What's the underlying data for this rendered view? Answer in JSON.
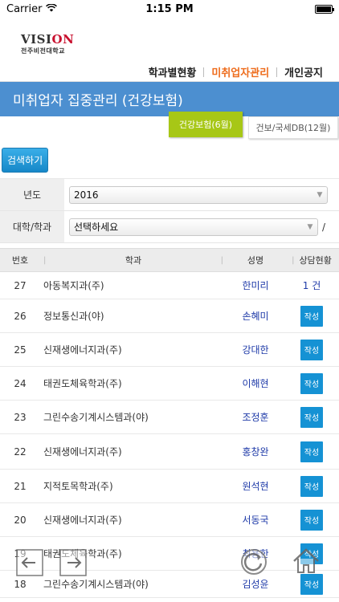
{
  "status": {
    "carrier": "Carrier",
    "time": "1:15 PM"
  },
  "logo": {
    "main_prefix": "VISI",
    "main_suffix": "ON",
    "sub": "전주비전대학교"
  },
  "nav": {
    "items": [
      {
        "label": "학과별현황",
        "active": false
      },
      {
        "label": "미취업자관리",
        "active": true
      },
      {
        "label": "개인공지",
        "active": false
      }
    ]
  },
  "title": "미취업자 집중관리 (건강보험)",
  "tabs": {
    "active": "건강보험(6월)",
    "other": "건보/국세DB(12월)"
  },
  "search": {
    "button": "검색하기"
  },
  "form": {
    "year_label": "년도",
    "year_value": "2016",
    "dept_label": "대학/학과",
    "dept_value": "선택하세요",
    "slash": "/"
  },
  "table": {
    "headers": {
      "no": "번호",
      "dept": "학과",
      "name": "성명",
      "status": "상담현황"
    },
    "write_label": "작성",
    "rows": [
      {
        "no": "27",
        "dept": "아동복지과(주)",
        "name": "한미리",
        "status": "1 건"
      },
      {
        "no": "26",
        "dept": "정보통신과(야)",
        "name": "손혜미",
        "status": ""
      },
      {
        "no": "25",
        "dept": "신재생에너지과(주)",
        "name": "강대한",
        "status": ""
      },
      {
        "no": "24",
        "dept": "태권도체육학과(주)",
        "name": "이해현",
        "status": ""
      },
      {
        "no": "23",
        "dept": "그린수송기계시스템과(야)",
        "name": "조정훈",
        "status": ""
      },
      {
        "no": "22",
        "dept": "신재생에너지과(주)",
        "name": "홍창완",
        "status": ""
      },
      {
        "no": "21",
        "dept": "지적토목학과(주)",
        "name": "원석현",
        "status": ""
      },
      {
        "no": "20",
        "dept": "신재생에너지과(주)",
        "name": "서동국",
        "status": ""
      },
      {
        "no": "19",
        "dept": "태권도체육학과(주)",
        "name": "최용한",
        "status": ""
      },
      {
        "no": "18",
        "dept": "그린수송기계시스템과(야)",
        "name": "김성윤",
        "status": ""
      }
    ]
  },
  "colors": {
    "title_bg": "#4c8fd0",
    "tab_active": "#a7c716",
    "accent": "#ee6c1c",
    "button": "#1592d4",
    "name": "#1e3aa8"
  }
}
